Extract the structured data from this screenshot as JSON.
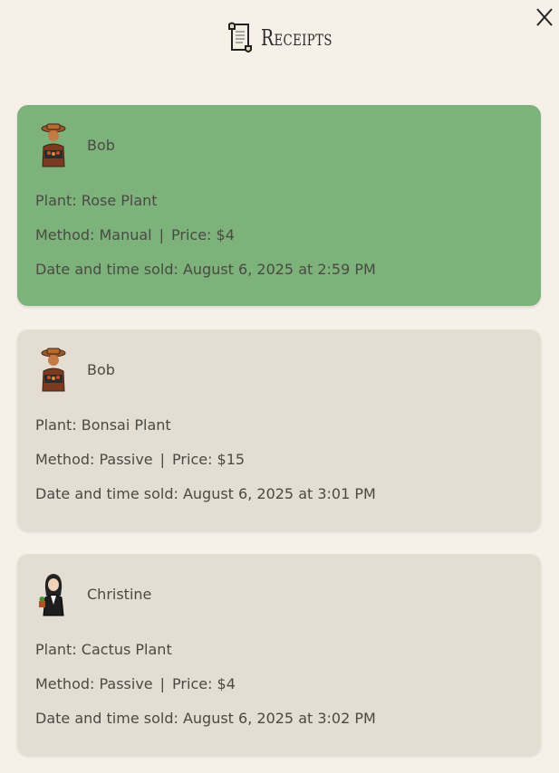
{
  "header": {
    "title": "Receipts",
    "icon": "scroll-icon",
    "close_label": "X"
  },
  "receipts": [
    {
      "buyer": "Bob",
      "plant": "Plant: Rose Plant",
      "method": "Method: Manual",
      "separator": "|",
      "price": "Price: $4",
      "date": "Date and time sold: August 6, 2025 at 2:59 PM",
      "highlighted": true,
      "avatar": "farmer-avatar-icon"
    },
    {
      "buyer": "Bob",
      "plant": "Plant: Bonsai Plant",
      "method": "Method: Passive",
      "separator": "|",
      "price": "Price: $15",
      "date": "Date and time sold: August 6, 2025 at 3:01 PM",
      "highlighted": false,
      "avatar": "farmer-avatar-icon"
    },
    {
      "buyer": "Christine",
      "plant": "Plant: Cactus Plant",
      "method": "Method: Passive",
      "separator": "|",
      "price": "Price: $4",
      "date": "Date and time sold: August 6, 2025 at 3:02 PM",
      "highlighted": false,
      "avatar": "businesswoman-avatar-icon"
    }
  ],
  "colors": {
    "background": "#f6f0e9",
    "highlight_card": "#7db27b",
    "normal_card": "#e3ddd2",
    "text": "#4a4a44"
  }
}
